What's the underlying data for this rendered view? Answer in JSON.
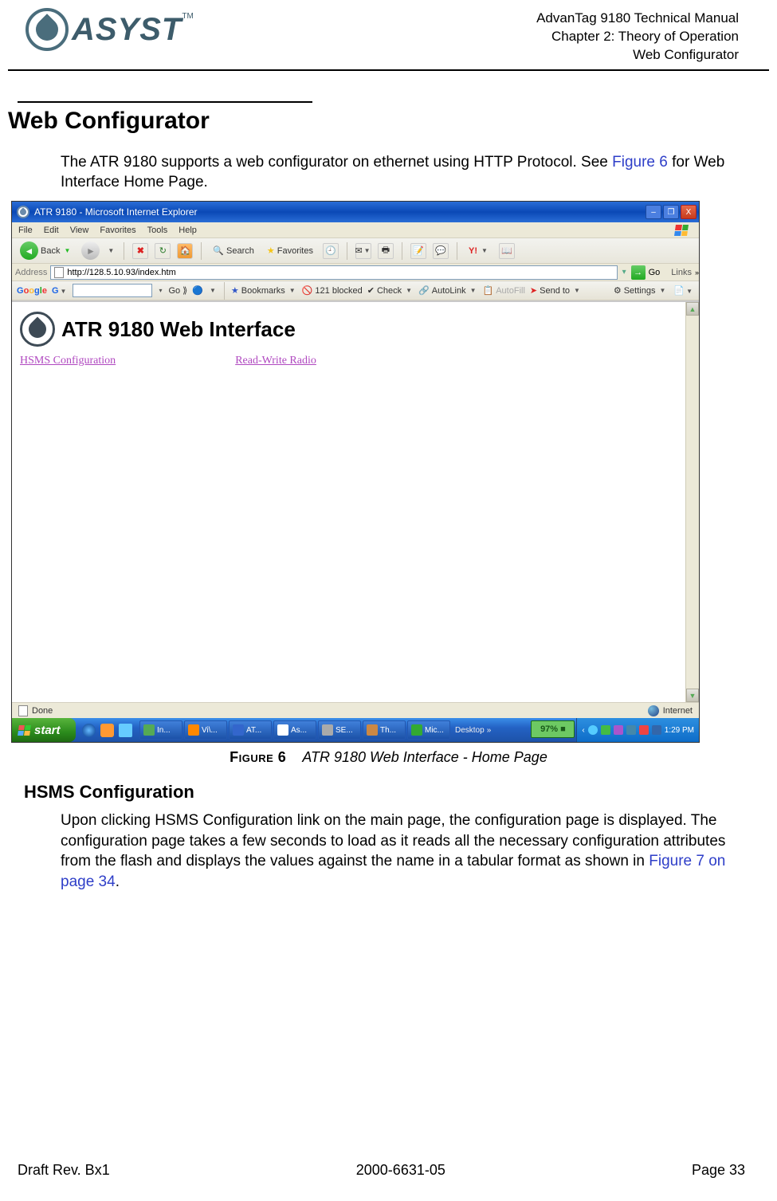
{
  "header": {
    "logo_text": "ASYST",
    "tm": "TM",
    "line1": "AdvanTag 9180 Technical Manual",
    "line2": "Chapter 2: Theory of Operation",
    "line3": "Web Configurator"
  },
  "h1": "Web Configurator",
  "intro": {
    "part1": "The ATR 9180 supports a web configurator on ethernet using HTTP Protocol. See ",
    "link": "Figure 6",
    "part2": " for Web Interface Home Page."
  },
  "screenshot": {
    "title": "ATR 9180 - Microsoft Internet Explorer",
    "window_buttons": {
      "min": "–",
      "max": "❐",
      "close": "X"
    },
    "menubar": {
      "file": "File",
      "edit": "Edit",
      "view": "View",
      "favorites": "Favorites",
      "tools": "Tools",
      "help": "Help"
    },
    "toolbar": {
      "back": "Back",
      "search": "Search",
      "favorites": "Favorites"
    },
    "address": {
      "label": "Address",
      "url": "http://128.5.10.93/index.htm",
      "go": "Go",
      "links": "Links"
    },
    "google": {
      "brand": "Google",
      "go": "Go",
      "bookmarks": "Bookmarks",
      "blocked": "121 blocked",
      "check": "Check",
      "autolink": "AutoLink",
      "autofill": "AutoFill",
      "send": "Send to",
      "settings": "Settings"
    },
    "content": {
      "heading": "ATR 9180 Web Interface",
      "link1": "HSMS Configuration",
      "link2": "Read-Write Radio"
    },
    "status": {
      "left": "Done",
      "right": "Internet"
    },
    "taskbar": {
      "start": "start",
      "items": [
        "In...",
        "Vi\\...",
        "AT...",
        "As...",
        "SE...",
        "Th...",
        "Mic..."
      ],
      "desktop": "Desktop",
      "percent": "97%",
      "time": "1:29 PM"
    }
  },
  "figure": {
    "label": "Figure 6",
    "title": "ATR 9180 Web Interface - Home Page"
  },
  "h2": "HSMS Configuration",
  "hsms_para": {
    "part1": "Upon clicking HSMS Configuration link on the main page, the configuration page is displayed. The configuration page takes a few seconds to load as it reads all the necessary configuration attributes from the flash and displays the values against the name in a tabular format as shown in ",
    "link": "Figure 7 on page 34",
    "part2": "."
  },
  "footer": {
    "left": "Draft Rev. Bx1",
    "center": "2000-6631-05",
    "right": "Page 33"
  }
}
